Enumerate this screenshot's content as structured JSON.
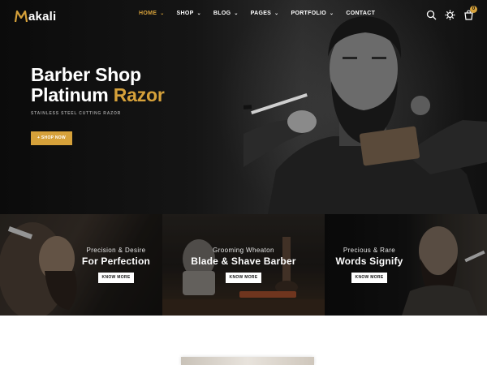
{
  "brand": {
    "name": "akali",
    "accent_color": "#d6a13a"
  },
  "nav": {
    "items": [
      {
        "label": "HOME",
        "has_dropdown": true,
        "active": true
      },
      {
        "label": "SHOP",
        "has_dropdown": true,
        "active": false
      },
      {
        "label": "BLOG",
        "has_dropdown": true,
        "active": false
      },
      {
        "label": "PAGES",
        "has_dropdown": true,
        "active": false
      },
      {
        "label": "PORTFOLIO",
        "has_dropdown": true,
        "active": false
      },
      {
        "label": "CONTACT",
        "has_dropdown": false,
        "active": false
      }
    ],
    "icons": [
      "search-icon",
      "settings-icon",
      "cart-icon"
    ],
    "cart_count": "0"
  },
  "hero": {
    "title_line1": "Barber Shop",
    "title_line2_plain": "Platinum ",
    "title_line2_accent": "Razor",
    "subtitle": "STAINLESS STEEL CUTTING RAZOR",
    "button_label": "+ SHOP NOW"
  },
  "banners": [
    {
      "pre": "Precision & Desire",
      "main": "For Perfection",
      "button": "KNOW MORE"
    },
    {
      "pre": "Grooming Wheaton",
      "main": "Blade & Shave Barber",
      "button": "KNOW MORE"
    },
    {
      "pre": "Precious & Rare",
      "main": "Words Signify",
      "button": "KNOW MORE"
    }
  ]
}
